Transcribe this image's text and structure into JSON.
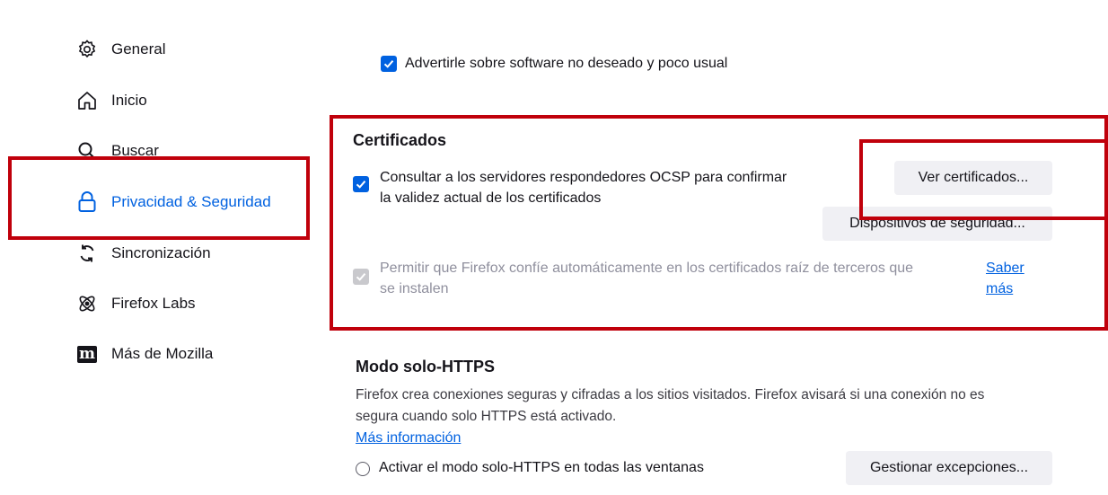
{
  "colors": {
    "accent": "#0061e0",
    "highlight": "#c0000b"
  },
  "sidebar": {
    "items": [
      {
        "label": "General",
        "icon": "gear-icon"
      },
      {
        "label": "Inicio",
        "icon": "home-icon"
      },
      {
        "label": "Buscar",
        "icon": "search-icon"
      },
      {
        "label": "Privacidad & Seguridad",
        "icon": "lock-icon",
        "active": true
      },
      {
        "label": "Sincronización",
        "icon": "sync-icon"
      },
      {
        "label": "Firefox Labs",
        "icon": "labs-icon"
      },
      {
        "label": "Más de Mozilla",
        "icon": "mozilla-icon"
      }
    ]
  },
  "main": {
    "unwanted_software": {
      "label": "Advertirle sobre software no deseado y poco usual",
      "checked": true
    },
    "certificates": {
      "heading": "Certificados",
      "ocsp": {
        "line1": "Consultar a los servidores respondedores OCSP para confirmar",
        "line2": "la validez actual de los certificados",
        "checked": true
      },
      "view_button": "Ver certificados...",
      "devices_button": "Dispositivos de seguridad...",
      "third_party": {
        "line1": "Permitir que Firefox confíe automáticamente en los certificados raíz de terceros que",
        "line2": "se instalen",
        "checked": true,
        "disabled": true
      },
      "learn_more": {
        "line1": "Saber",
        "line2": "más"
      }
    },
    "https_only": {
      "heading": "Modo solo-HTTPS",
      "desc1": "Firefox crea conexiones seguras y cifradas a los sitios visitados. Firefox avisará si una conexión no es",
      "desc2": "segura cuando solo HTTPS está activado.",
      "more_info": "Más información",
      "option_all": "Activar el modo solo-HTTPS en todas las ventanas",
      "exceptions_button": "Gestionar excepciones..."
    }
  }
}
